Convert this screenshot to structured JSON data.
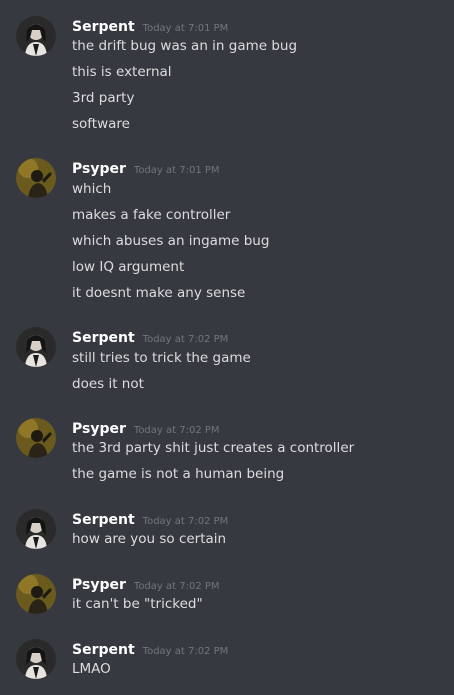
{
  "messages": [
    {
      "username": "Serpent",
      "timestamp": "Today at 7:01 PM",
      "avatar": "serpent-avatar",
      "lines": [
        "the drift bug was an in game bug",
        "this is external",
        "3rd party",
        "software"
      ]
    },
    {
      "username": "Psyper",
      "timestamp": "Today at 7:01 PM",
      "avatar": "psyper-avatar",
      "lines": [
        "which",
        "makes a fake controller",
        "which abuses an ingame bug",
        "low IQ argument",
        "it doesnt make any sense"
      ]
    },
    {
      "username": "Serpent",
      "timestamp": "Today at 7:02 PM",
      "avatar": "serpent-avatar",
      "lines": [
        "still tries to trick the game",
        "does it not"
      ]
    },
    {
      "username": "Psyper",
      "timestamp": "Today at 7:02 PM",
      "avatar": "psyper-avatar",
      "lines": [
        "the 3rd party shit just creates a controller",
        "the game is not a human being"
      ]
    },
    {
      "username": "Serpent",
      "timestamp": "Today at 7:02 PM",
      "avatar": "serpent-avatar",
      "lines": [
        "how are you so certain"
      ]
    },
    {
      "username": "Psyper",
      "timestamp": "Today at 7:02 PM",
      "avatar": "psyper-avatar",
      "lines": [
        "it can't be \"tricked\""
      ]
    },
    {
      "username": "Serpent",
      "timestamp": "Today at 7:02 PM",
      "avatar": "serpent-avatar",
      "lines": [
        "LMAO"
      ]
    }
  ],
  "colors": {
    "background": "#36393f",
    "username": "#ffffff",
    "timestamp": "#72767d",
    "text": "#dcddde"
  }
}
